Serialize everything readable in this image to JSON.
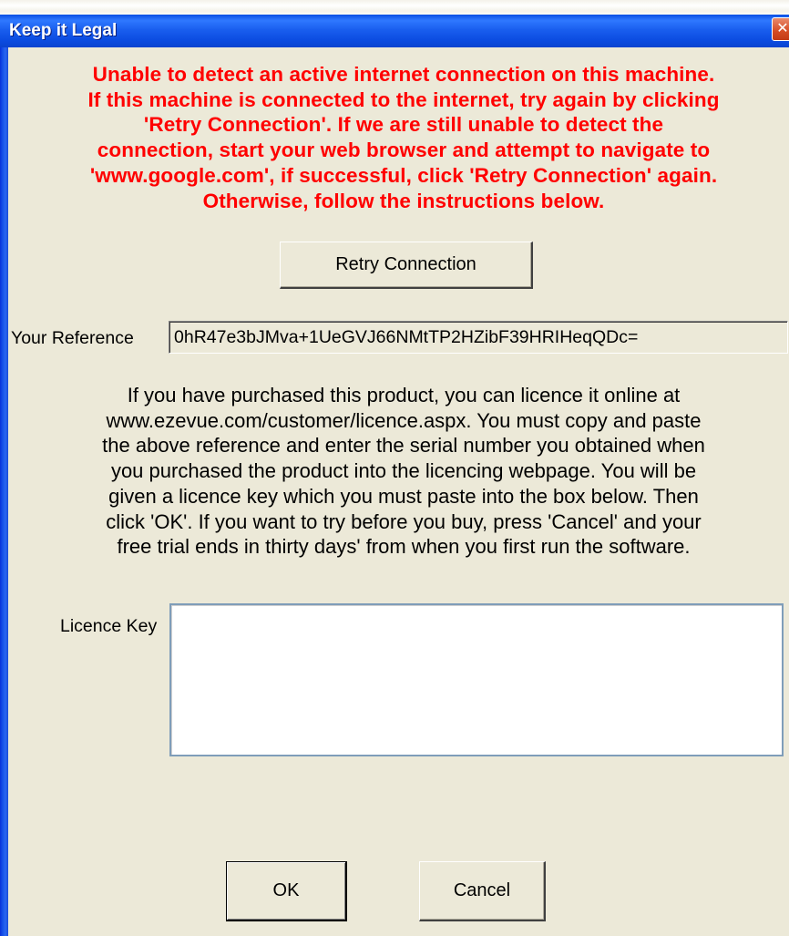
{
  "window": {
    "title": "Keep it Legal",
    "close_glyph": "✕",
    "close_icon": "close-icon"
  },
  "warning_lines": [
    "Unable to detect an active internet connection on this machine.",
    "If this machine is connected to the internet, try again by clicking",
    "'Retry Connection'.   If we are still unable to detect the",
    "connection, start your web browser and attempt to navigate to",
    "'www.google.com', if successful, click 'Retry Connection' again.",
    "Otherwise, follow the instructions below."
  ],
  "retry_button": {
    "label": "Retry Connection"
  },
  "reference": {
    "label": "Your Reference",
    "value": "0hR47e3bJMva+1UeGVJ66NMtTP2HZibF39HRIHeqQDc="
  },
  "instruction_lines": [
    "If you have purchased this product, you can licence it online at",
    "www.ezevue.com/customer/licence.aspx.  You must copy and paste",
    "the above reference and enter the serial number you obtained when",
    "you purchased the product into the licencing webpage.  You will be",
    "given a licence key which you must paste into the box below.  Then",
    "click 'OK'.  If you want to try before you buy, press 'Cancel' and your",
    "free trial ends in thirty days' from when you first run the software."
  ],
  "licence": {
    "label": "Licence Key",
    "value": ""
  },
  "buttons": {
    "ok_label": "OK",
    "cancel_label": "Cancel"
  },
  "colors": {
    "warning_text": "#ff0000",
    "dialog_background": "#ece9d8",
    "titlebar_blue": "#0a4fe3"
  }
}
